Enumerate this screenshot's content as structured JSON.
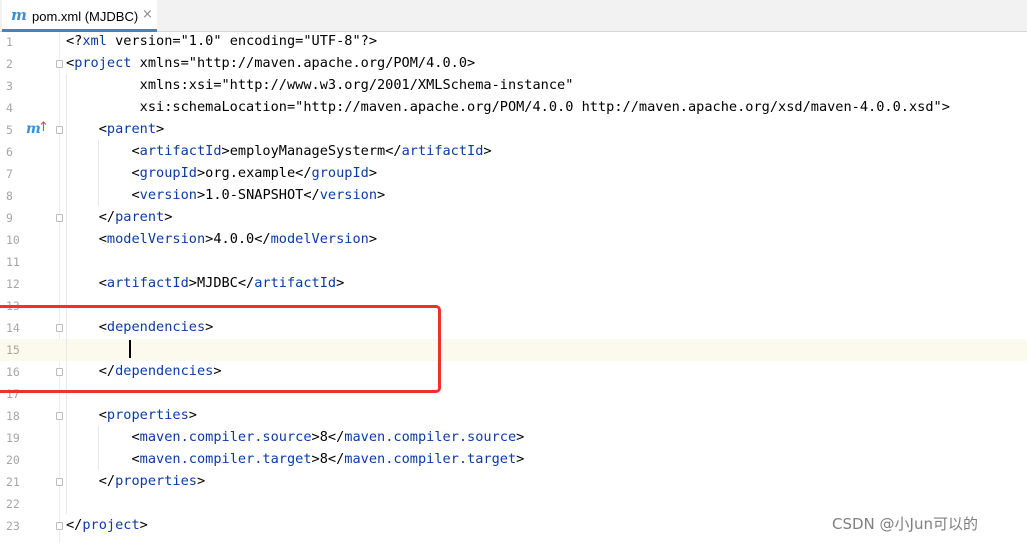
{
  "tab": {
    "icon": "maven-icon",
    "icon_glyph": "m",
    "title": "pom.xml (MJDBC)",
    "close_glyph": "×"
  },
  "gutter": {
    "maven_marker_glyph": "m",
    "maven_arrow_glyph": "↑",
    "line_numbers": [
      "1",
      "2",
      "3",
      "4",
      "5",
      "6",
      "7",
      "8",
      "9",
      "10",
      "11",
      "12",
      "13",
      "14",
      "15",
      "16",
      "17",
      "18",
      "19",
      "20",
      "21",
      "22",
      "23"
    ]
  },
  "editor": {
    "current_line": 15,
    "lines": [
      "<?xml version=\"1.0\" encoding=\"UTF-8\"?>",
      "<project xmlns=\"http://maven.apache.org/POM/4.0.0\"",
      "         xmlns:xsi=\"http://www.w3.org/2001/XMLSchema-instance\"",
      "         xsi:schemaLocation=\"http://maven.apache.org/POM/4.0.0 http://maven.apache.org/xsd/maven-4.0.0.xsd\">",
      "    <parent>",
      "        <artifactId>employManageSysterm</artifactId>",
      "        <groupId>org.example</groupId>",
      "        <version>1.0-SNAPSHOT</version>",
      "    </parent>",
      "    <modelVersion>4.0.0</modelVersion>",
      "",
      "    <artifactId>MJDBC</artifactId>",
      "",
      "    <dependencies>",
      "",
      "    </dependencies>",
      "",
      "    <properties>",
      "        <maven.compiler.source>8</maven.compiler.source>",
      "        <maven.compiler.target>8</maven.compiler.target>",
      "    </properties>",
      "",
      "</project>"
    ]
  },
  "colors": {
    "tag": "#0b3aa6",
    "attr_namespace": "#871094",
    "value": "#067d17",
    "highlight_box": "#f0302a",
    "current_line": "#fcfaed"
  },
  "watermark": "CSDN @小Jun可以的"
}
